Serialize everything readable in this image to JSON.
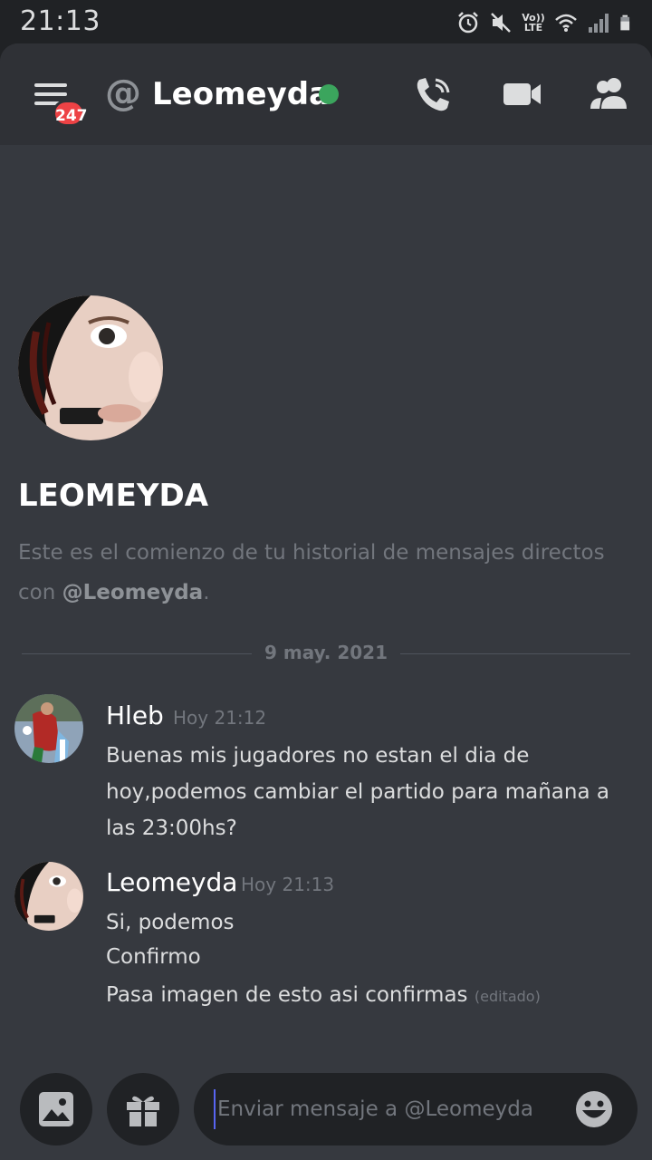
{
  "status_bar": {
    "time": "21:13",
    "volte_top": "Vo))",
    "volte_bottom": "LTE"
  },
  "header": {
    "badge_count": "247",
    "at_symbol": "@",
    "channel_name": "Leomeyda",
    "status": "online",
    "status_color": "#3ba55d"
  },
  "intro": {
    "name": "LEOMEYDA",
    "desc_prefix": "Este es el comienzo de tu historial de mensajes directos con ",
    "desc_handle": "@Leomeyda",
    "desc_suffix": "."
  },
  "date_divider": "9 may. 2021",
  "messages": [
    {
      "author": "Hleb",
      "time": "Hoy 21:12",
      "text": "Buenas mis jugadores no estan el dia de hoy,podemos cambiar el partido para mañana a las 23:00hs?"
    },
    {
      "author": "Leomeyda",
      "time": "Hoy 21:13",
      "lines": [
        "Si, podemos",
        "Confirmo",
        "Pasa imagen de esto asi confirmas"
      ],
      "edited": "(editado)"
    }
  ],
  "composer": {
    "placeholder": "Enviar mensaje a @Leomeyda"
  },
  "colors": {
    "background": "#36393f",
    "header": "#2f3136",
    "badge": "#ed4245",
    "accent": "#5865f2"
  },
  "icons": [
    "alarm-icon",
    "mute-icon",
    "wifi-icon",
    "signal-icon",
    "battery-icon",
    "hamburger-menu-icon",
    "at-icon",
    "voice-call-icon",
    "video-call-icon",
    "members-icon",
    "image-icon",
    "gift-icon",
    "emoji-icon"
  ]
}
